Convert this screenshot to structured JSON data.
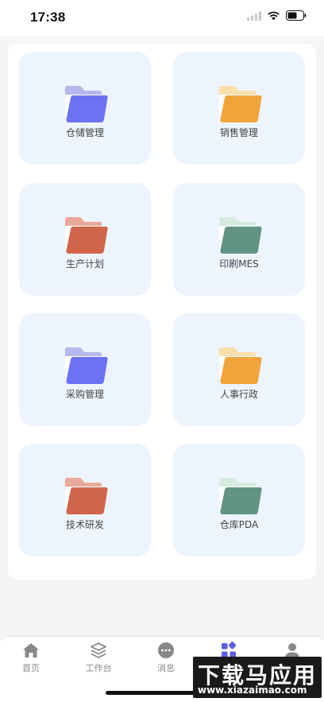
{
  "status_bar": {
    "time": "17:38"
  },
  "tiles": [
    {
      "label": "仓储管理",
      "back": "#b5b8ef",
      "front": "#6c72f4"
    },
    {
      "label": "销售管理",
      "back": "#f8dfac",
      "front": "#f0a43c"
    },
    {
      "label": "生产计划",
      "back": "#e8a99a",
      "front": "#d0654c"
    },
    {
      "label": "印刷MES",
      "back": "#d6ebe0",
      "front": "#629384"
    },
    {
      "label": "采购管理",
      "back": "#b5b8ef",
      "front": "#6c72f4"
    },
    {
      "label": "人事行政",
      "back": "#f8dfac",
      "front": "#f0a43c"
    },
    {
      "label": "技术研发",
      "back": "#e8a99a",
      "front": "#d0654c"
    },
    {
      "label": "仓库PDA",
      "back": "#d6ebe0",
      "front": "#629384"
    }
  ],
  "tab_bar": {
    "items": [
      {
        "label": "首页",
        "icon": "home-icon"
      },
      {
        "label": "工作台",
        "icon": "layers-icon"
      },
      {
        "label": "消息",
        "icon": "message-icon"
      },
      {
        "label": "",
        "icon": "apps-icon",
        "active": true
      },
      {
        "label": "",
        "icon": "user-icon"
      }
    ],
    "colors": {
      "inactive": "#888888",
      "active": "#5a5fe0"
    }
  },
  "watermark": {
    "main": "下载马应用",
    "sub": "www.xiazaimao.com"
  }
}
